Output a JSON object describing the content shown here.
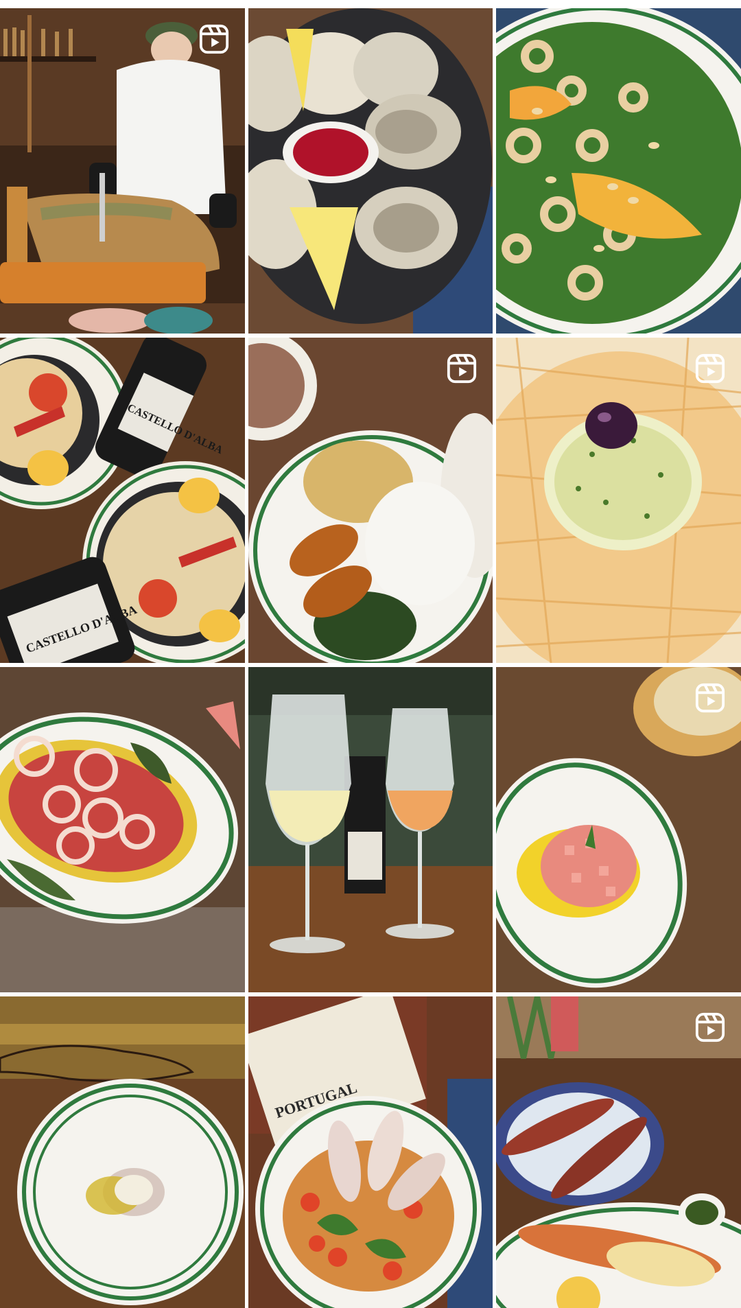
{
  "profile_grid": {
    "posts": [
      {
        "id": "post-1",
        "subject": "ham-carving",
        "is_reel": true
      },
      {
        "id": "post-2",
        "subject": "oysters",
        "is_reel": false
      },
      {
        "id": "post-3",
        "subject": "squid-salad",
        "is_reel": false
      },
      {
        "id": "post-4",
        "subject": "cod-platter-wine",
        "is_reel": false
      },
      {
        "id": "post-5",
        "subject": "croquettes-rice",
        "is_reel": true
      },
      {
        "id": "post-6",
        "subject": "bacalhau-straw-potatoes",
        "is_reel": true
      },
      {
        "id": "post-7",
        "subject": "carpaccio-onions",
        "is_reel": false
      },
      {
        "id": "post-8",
        "subject": "wine-glasses",
        "is_reel": false
      },
      {
        "id": "post-9",
        "subject": "tuna-tartare",
        "is_reel": true
      },
      {
        "id": "post-10",
        "subject": "scallop",
        "is_reel": false
      },
      {
        "id": "post-11",
        "subject": "stuffed-squid",
        "is_reel": false
      },
      {
        "id": "post-12",
        "subject": "grilled-prawns",
        "is_reel": true
      }
    ],
    "printed_labels": {
      "wine_bottle_brand_1": "CASTELLO D'ALBA",
      "wine_bottle_brand_2": "CASTELLO D'ALBA",
      "map_title": "PORTUGAL"
    },
    "colors": {
      "plate_rim_green": "#2f7a3e",
      "wood_dark": "#4a2d1c",
      "wood_mid": "#7a4f30",
      "reel_icon": "#ffffff"
    },
    "icons": {
      "reel": "reels-icon"
    }
  }
}
